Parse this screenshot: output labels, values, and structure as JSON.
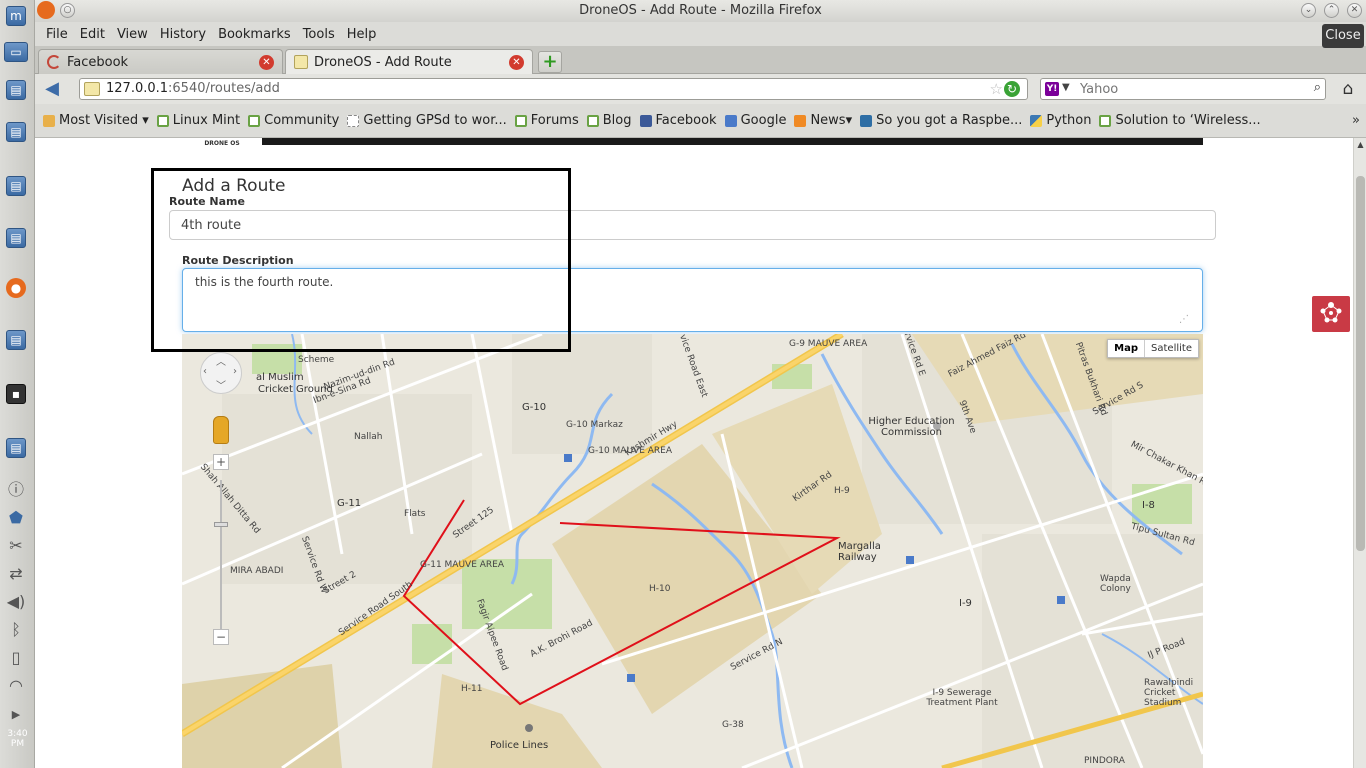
{
  "window": {
    "title": "DroneOS - Add Route - Mozilla Firefox",
    "tooltip": "Close"
  },
  "system_panel": {
    "clock": "3:40 PM",
    "icons": [
      "mint-menu-icon",
      "desktop-icon",
      "window-icon",
      "firefox-icon",
      "terminal-icon",
      "document-icon",
      "info-icon",
      "shield-icon",
      "network-icon",
      "volume-icon",
      "bluetooth-icon",
      "battery-icon",
      "wifi-icon"
    ]
  },
  "menubar": {
    "items": [
      {
        "label": "File"
      },
      {
        "label": "Edit"
      },
      {
        "label": "View"
      },
      {
        "label": "History"
      },
      {
        "label": "Bookmarks"
      },
      {
        "label": "Tools"
      },
      {
        "label": "Help"
      }
    ]
  },
  "tabs": [
    {
      "label": "Facebook",
      "active": false
    },
    {
      "label": "DroneOS - Add Route",
      "active": true
    }
  ],
  "navbar": {
    "url_host": "127.0.0.1",
    "url_path": ":6540/routes/add",
    "search_placeholder": "Yahoo",
    "search_engine": "Y!"
  },
  "bookmarks": [
    {
      "label": "Most Visited",
      "icon": "page"
    },
    {
      "label": "Linux Mint",
      "icon": "mint"
    },
    {
      "label": "Community",
      "icon": "mint"
    },
    {
      "label": "Getting GPSd to wor...",
      "icon": "page"
    },
    {
      "label": "Forums",
      "icon": "mint"
    },
    {
      "label": "Blog",
      "icon": "mint"
    },
    {
      "label": "Facebook",
      "icon": "fb"
    },
    {
      "label": "Google",
      "icon": "gg"
    },
    {
      "label": "News",
      "icon": "rss"
    },
    {
      "label": "So you got a Raspbe...",
      "icon": "net"
    },
    {
      "label": "Python",
      "icon": "py"
    },
    {
      "label": "Solution to ‘Wireless...",
      "icon": "mint"
    }
  ],
  "page": {
    "logo": "DRONE OS",
    "form_title": "Add a Route",
    "route_name_label": "Route Name",
    "route_name_value": "4th route",
    "route_desc_label": "Route Description",
    "route_desc_value": "this is the fourth route. "
  },
  "map": {
    "type_buttons": {
      "map": "Map",
      "satellite": "Satellite"
    },
    "route_color": "#e0101a",
    "labels": [
      "Scheme",
      "Nazim-ud-din Rd",
      "Ibn-e-Sina Rd",
      "al Muslim",
      "Cricket Ground",
      "Nallah",
      "G-10",
      "G-10 Markaz",
      "G-10 MAUVE AREA",
      "G-9 MAUVE AREA",
      "Service Road East",
      "Kashmir Hwy",
      "G-11",
      "Flats",
      "Street 125",
      "G-11 MAUVE AREA",
      "MIRA ABADI",
      "Shah Allah Ditta Rd",
      "Service Rd W",
      "Street 2",
      "Service Road South",
      "Fagir Aipee Road",
      "A.K. Brohi Road",
      "H-10",
      "H-11",
      "Police Lines",
      "Higher Education Commission",
      "Kirthar Rd",
      "H-9",
      "Margalla Railway",
      "Faiz Ahmed Faiz Rd",
      "Service Rd E",
      "9th Ave",
      "Pitras Bukhari Rd",
      "Service Rd S",
      "Mir Chakar Khan Rd",
      "I-8",
      "Tipu Sultan Rd",
      "Wapda Colony",
      "I-9",
      "Service Rd N",
      "I-9 Sewerage Treatment Plant",
      "IJ P Road",
      "Rawalpindi Cricket Stadium",
      "PINDORA",
      "G-38"
    ]
  }
}
